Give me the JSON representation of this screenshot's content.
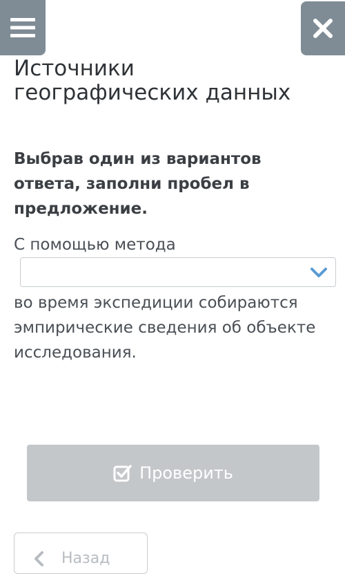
{
  "header": {
    "menu_icon": "hamburger-menu-icon",
    "close_icon": "close-x-icon",
    "button_color": "#7f8c95"
  },
  "title": "Источники географических данных",
  "instruction": "Выбрав один из вариантов ответа, заполни пробел в предложение.",
  "question": {
    "text_before": "С помощью метода",
    "dropdown_selected": "",
    "dropdown_icon": "chevron-down-icon",
    "dropdown_icon_color": "#5a9bd5",
    "text_after": " во время экспедиции собираются эмпирические сведения об объекте исследования."
  },
  "actions": {
    "check_label": "Проверить",
    "check_icon": "checkbox-check-icon",
    "check_button_color": "#c4c7ca",
    "back_label": "Назад",
    "back_icon": "arrow-left-icon"
  }
}
